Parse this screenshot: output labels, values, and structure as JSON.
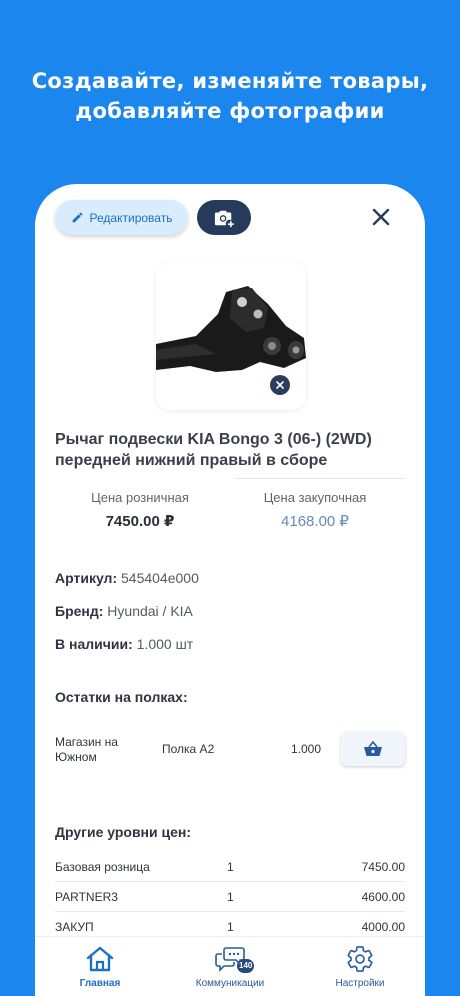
{
  "headline": {
    "line1": "Создавайте, изменяйте товары,",
    "line2": "добавляйте фотографии"
  },
  "toolbar": {
    "edit_label": "Редактировать",
    "edit_icon": "pencil-icon",
    "photo_icon": "camera-plus-icon",
    "close_icon": "close-icon"
  },
  "product": {
    "title": "Рычаг подвески KIA Bongo 3 (06-) (2WD) передней нижний правый в сборе",
    "retail_price_label": "Цена розничная",
    "retail_price": "7450.00 ₽",
    "purchase_price_label": "Цена закупочная",
    "purchase_price": "4168.00 ₽",
    "article_label": "Артикул:",
    "article": "545404e000",
    "brand_label": "Бренд:",
    "brand": "Hyundai / KIA",
    "stock_label": "В наличии:",
    "stock": "1.000 шт"
  },
  "shelves": {
    "title": "Остатки на полках:",
    "rows": [
      {
        "store": "Магазин на Южном",
        "shelf": "Полка А2",
        "qty": "1.000"
      }
    ]
  },
  "price_levels": {
    "title": "Другие уровни цен:",
    "rows": [
      {
        "name": "Базовая розница",
        "qty": "1",
        "price": "7450.00"
      },
      {
        "name": "PARTNER3",
        "qty": "1",
        "price": "4600.00"
      },
      {
        "name": "ЗАКУП",
        "qty": "1",
        "price": "4000.00"
      }
    ]
  },
  "nav": {
    "items": [
      {
        "label": "Главная",
        "icon": "home-icon"
      },
      {
        "label": "Коммуникации",
        "icon": "chat-bubbles-icon",
        "badge": "140"
      },
      {
        "label": "Настройки",
        "icon": "gear-icon"
      }
    ]
  },
  "colors": {
    "background": "#1a86ee",
    "accent": "#1a6fc9",
    "dark_button": "#263a5c"
  }
}
